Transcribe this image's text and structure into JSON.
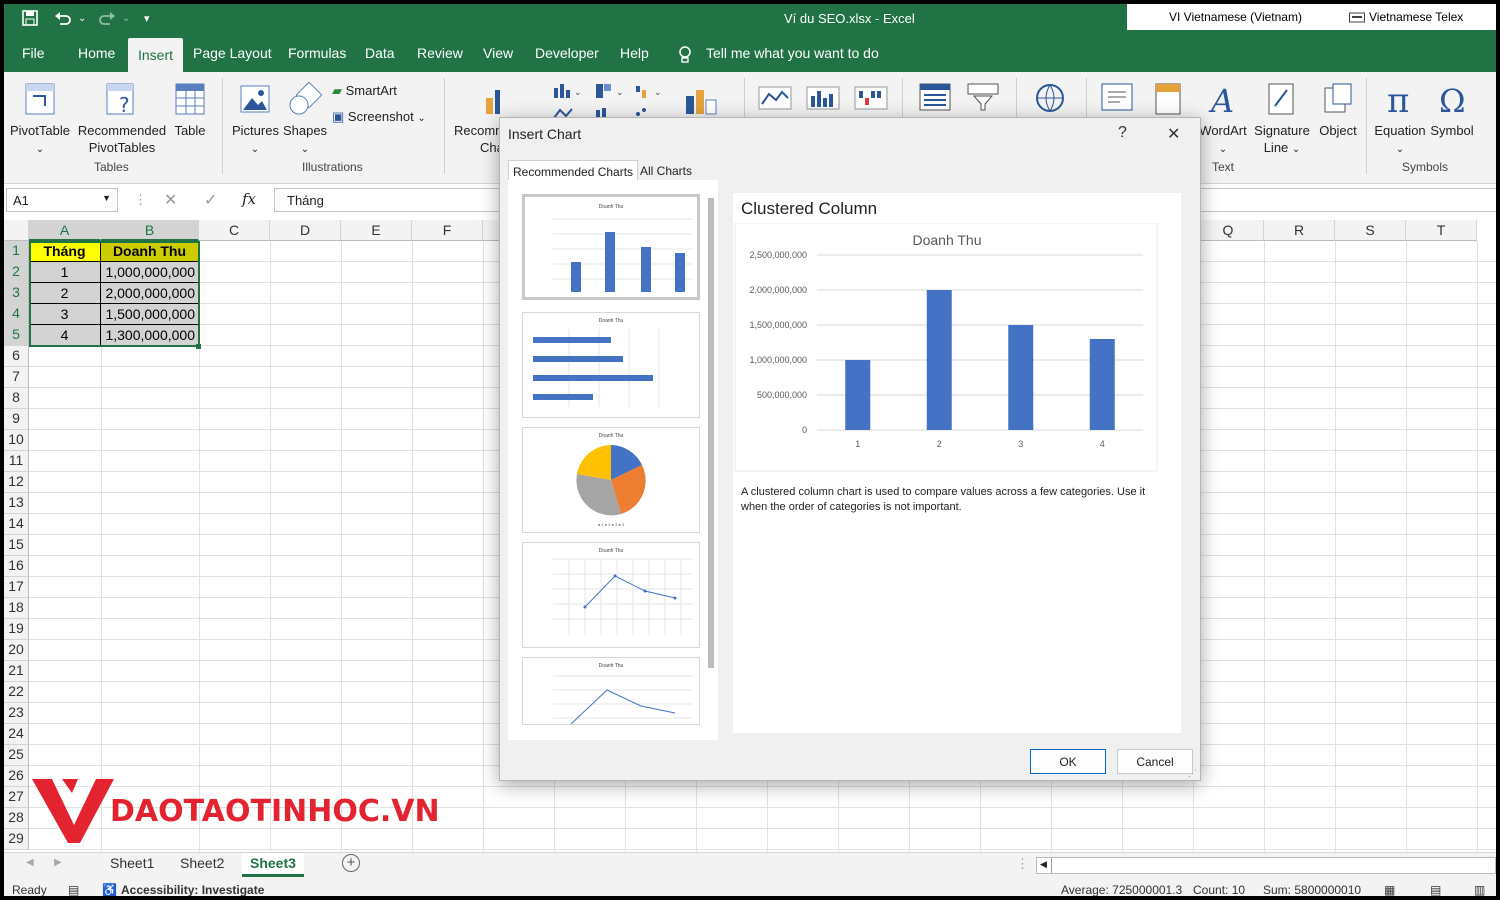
{
  "window": {
    "title": "Ví du SEO.xlsx  -  Excel"
  },
  "ime": {
    "language": "VI  Vietnamese (Vietnam)",
    "input": "Vietnamese Telex"
  },
  "menu": [
    "File",
    "Home",
    "Insert",
    "Page Layout",
    "Formulas",
    "Data",
    "Review",
    "View",
    "Developer",
    "Help"
  ],
  "search": {
    "label": "Tell me what you want to do"
  },
  "ribbon": {
    "pivottable": "PivotTable",
    "recommended_line1": "Recommended",
    "recommended_line2": "PivotTables",
    "table": "Table",
    "group_tables": "Tables",
    "pictures": "Pictures",
    "shapes": "Shapes",
    "smartart": "SmartArt",
    "screenshot": "Screenshot",
    "group_illustrations": "Illustrations",
    "recom_partial": "Recomm",
    "cha_partial": "Cha",
    "wordart": "WordArt",
    "signature_line1": "Signature",
    "signature_line2": "Line",
    "object": "Object",
    "group_text": "Text",
    "equation": "Equation",
    "symbol": "Symbol",
    "group_symbols": "Symbols"
  },
  "formula_bar": {
    "name_box": "A1",
    "fx": "fx",
    "value": "Tháng"
  },
  "columns": [
    "A",
    "B",
    "C",
    "D",
    "E",
    "F",
    "Q",
    "R",
    "S",
    "T"
  ],
  "rows": [
    "1",
    "2",
    "3",
    "4",
    "5",
    "6",
    "7",
    "8",
    "9",
    "10",
    "11",
    "12",
    "13",
    "14",
    "15",
    "16",
    "17",
    "18",
    "19",
    "20",
    "21",
    "22",
    "23",
    "24",
    "25",
    "26",
    "27",
    "28",
    "29"
  ],
  "table": {
    "headers": [
      "Tháng",
      "Doanh Thu"
    ],
    "rows": [
      [
        "1",
        "1,000,000,000"
      ],
      [
        "2",
        "2,000,000,000"
      ],
      [
        "3",
        "1,500,000,000"
      ],
      [
        "4",
        "1,300,000,000"
      ]
    ],
    "header_color": "#ffff00"
  },
  "logo": {
    "text": "DAOTAOTINHOC.VN",
    "color": "#e3232f"
  },
  "sheets": [
    "Sheet1",
    "Sheet2",
    "Sheet3"
  ],
  "status": {
    "ready": "Ready",
    "accessibility": "Accessibility: Investigate",
    "average": "Average: 725000001.3",
    "count": "Count: 10",
    "sum": "Sum: 5800000010"
  },
  "dialog": {
    "title": "Insert Chart",
    "help": "?",
    "close": "✕",
    "tabs": [
      "Recommended Charts",
      "All Charts"
    ],
    "thumb_title": "Doanh Thu",
    "preview_title": "Clustered Column",
    "description": "A clustered column chart is used to compare values across a few categories. Use it when the order of categories is not important.",
    "ok": "OK",
    "cancel": "Cancel"
  },
  "chart_data": {
    "type": "bar",
    "title": "Doanh Thu",
    "categories": [
      "1",
      "2",
      "3",
      "4"
    ],
    "values": [
      1000000000,
      2000000000,
      1500000000,
      1300000000
    ],
    "yticks": [
      "2,500,000,000",
      "2,000,000,000",
      "1,500,000,000",
      "1,000,000,000",
      "500,000,000",
      "0"
    ],
    "ylim": [
      0,
      2500000000
    ],
    "grid": true,
    "color": "#4472c4"
  }
}
